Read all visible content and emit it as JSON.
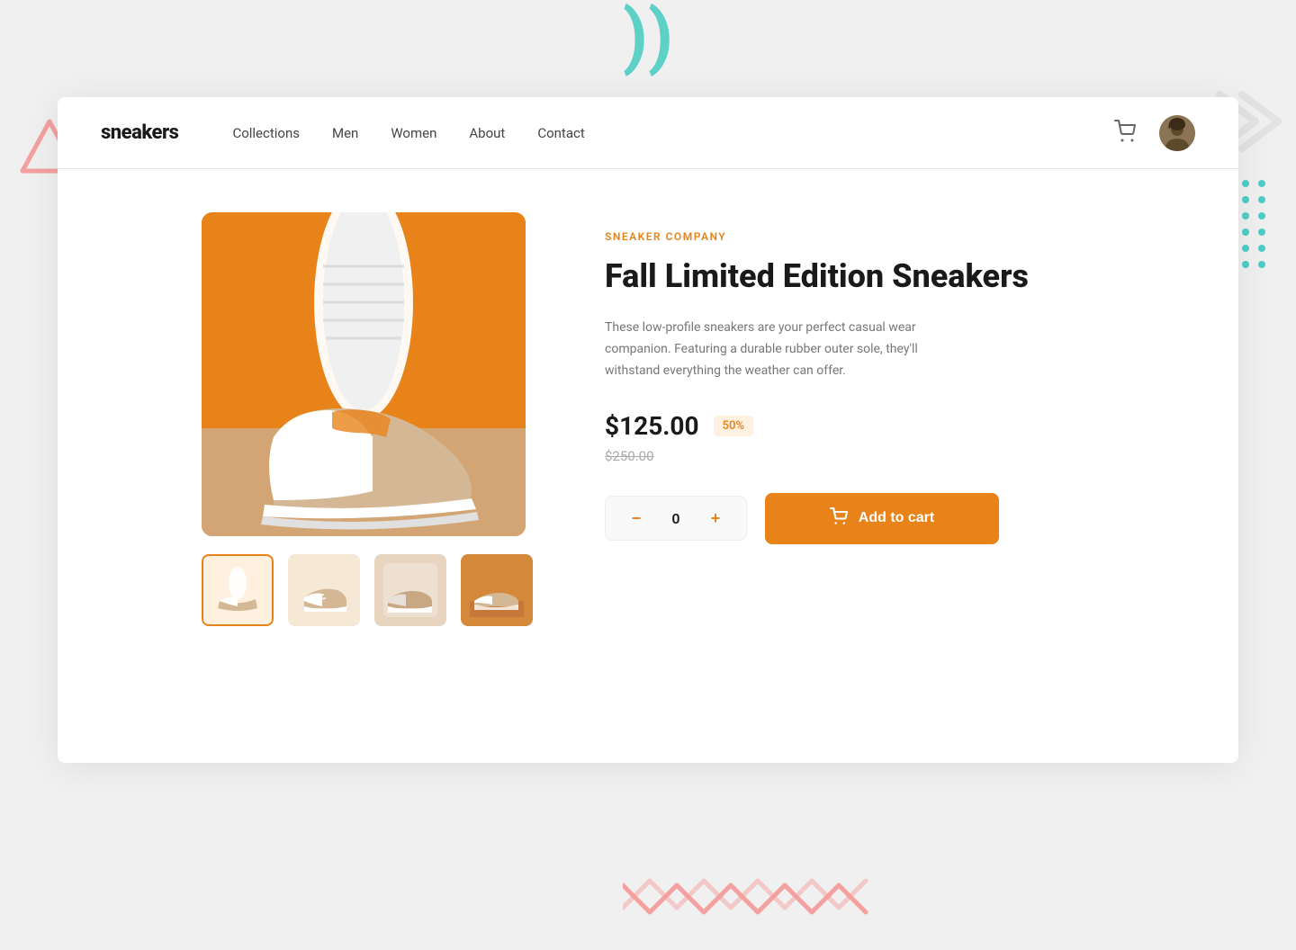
{
  "brand": {
    "name": "sneakers"
  },
  "nav": {
    "links": [
      {
        "label": "Collections",
        "id": "collections"
      },
      {
        "label": "Men",
        "id": "men"
      },
      {
        "label": "Women",
        "id": "women"
      },
      {
        "label": "About",
        "id": "about"
      },
      {
        "label": "Contact",
        "id": "contact"
      }
    ]
  },
  "product": {
    "brand_label": "SNEAKER COMPANY",
    "title": "Fall Limited Edition Sneakers",
    "description": "These low-profile sneakers are your perfect casual wear companion. Featuring a durable rubber outer sole, they'll withstand everything the weather can offer.",
    "current_price": "$125.00",
    "discount": "50%",
    "original_price": "$250.00",
    "quantity": "0",
    "add_to_cart_label": "Add to cart"
  },
  "buttons": {
    "qty_minus": "−",
    "qty_plus": "+"
  }
}
